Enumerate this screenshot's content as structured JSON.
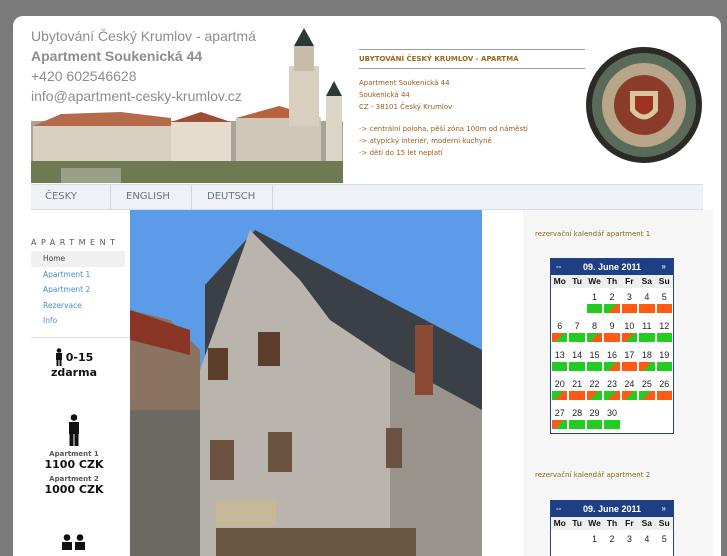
{
  "header": {
    "line1": "Ubytování Český Krumlov - apartmá",
    "line2": "Apartment Soukenická 44",
    "line3": "+420 602546628",
    "line4": "info@apartment-cesky-krumlov.cz"
  },
  "info": {
    "title": "UBYTOVÁNÍ ČESKÝ KRUMLOV - APARTMÁ",
    "address": [
      "Apartment Soukenická 44",
      "Soukenická 44",
      "CZ - 38101 Český Krumlov"
    ],
    "features": [
      "-> centrální poloha, pěší zóna 100m od náměstí",
      "-> atypický interiér, moderní kuchyně",
      "-> děti do 15 let neplatí"
    ]
  },
  "tabs": [
    "ČESKY",
    "ENGLISH",
    "DEUTSCH"
  ],
  "sidebar": {
    "title": "APARTMENT",
    "items": [
      "Home",
      "Apartment 1",
      "Apartment 2",
      "Rezervace",
      "Info"
    ]
  },
  "prices": {
    "kids_age": "0-15",
    "kids_price": "zdarma",
    "ap1_label": "Apartment 1",
    "ap1_price": "1100 CZK",
    "ap2_label": "Apartment 2",
    "ap2_price": "1000 CZK"
  },
  "calendars": [
    {
      "title": "rezervační kalendář apartment 1",
      "prev": "--",
      "month": "09. June 2011",
      "next": "»",
      "dow": [
        "Mo",
        "Tu",
        "We",
        "Th",
        "Fr",
        "Sa",
        "Su"
      ],
      "weeks": [
        [
          {
            "d": "",
            "s": ""
          },
          {
            "d": "",
            "s": ""
          },
          {
            "d": "1",
            "s": "g"
          },
          {
            "d": "2",
            "s": "go"
          },
          {
            "d": "3",
            "s": "o"
          },
          {
            "d": "4",
            "s": "o"
          },
          {
            "d": "5",
            "s": "o"
          }
        ],
        [
          {
            "d": "6",
            "s": "og"
          },
          {
            "d": "7",
            "s": "g"
          },
          {
            "d": "8",
            "s": "go"
          },
          {
            "d": "9",
            "s": "o"
          },
          {
            "d": "10",
            "s": "og"
          },
          {
            "d": "11",
            "s": "g"
          },
          {
            "d": "12",
            "s": "g"
          }
        ],
        [
          {
            "d": "13",
            "s": "g"
          },
          {
            "d": "14",
            "s": "g"
          },
          {
            "d": "15",
            "s": "g"
          },
          {
            "d": "16",
            "s": "go"
          },
          {
            "d": "17",
            "s": "o"
          },
          {
            "d": "18",
            "s": "og"
          },
          {
            "d": "19",
            "s": "g"
          }
        ],
        [
          {
            "d": "20",
            "s": "go"
          },
          {
            "d": "21",
            "s": "o"
          },
          {
            "d": "22",
            "s": "og"
          },
          {
            "d": "23",
            "s": "go"
          },
          {
            "d": "24",
            "s": "og"
          },
          {
            "d": "25",
            "s": "go"
          },
          {
            "d": "26",
            "s": "o"
          }
        ],
        [
          {
            "d": "27",
            "s": "og"
          },
          {
            "d": "28",
            "s": "g"
          },
          {
            "d": "29",
            "s": "g"
          },
          {
            "d": "30",
            "s": "g"
          },
          {
            "d": "",
            "s": ""
          },
          {
            "d": "",
            "s": ""
          },
          {
            "d": "",
            "s": ""
          }
        ]
      ]
    },
    {
      "title": "rezervační kalendář apartment 2",
      "prev": "--",
      "month": "09. June 2011",
      "next": "»",
      "dow": [
        "Mo",
        "Tu",
        "We",
        "Th",
        "Fr",
        "Sa",
        "Su"
      ],
      "weeks": [
        [
          {
            "d": "",
            "s": ""
          },
          {
            "d": "",
            "s": ""
          },
          {
            "d": "1",
            "s": ""
          },
          {
            "d": "2",
            "s": ""
          },
          {
            "d": "3",
            "s": ""
          },
          {
            "d": "4",
            "s": ""
          },
          {
            "d": "5",
            "s": ""
          }
        ]
      ]
    }
  ],
  "colors": {
    "free": "#22cc22",
    "booked": "#ff5a14",
    "calendar_header": "#1f3f84"
  }
}
